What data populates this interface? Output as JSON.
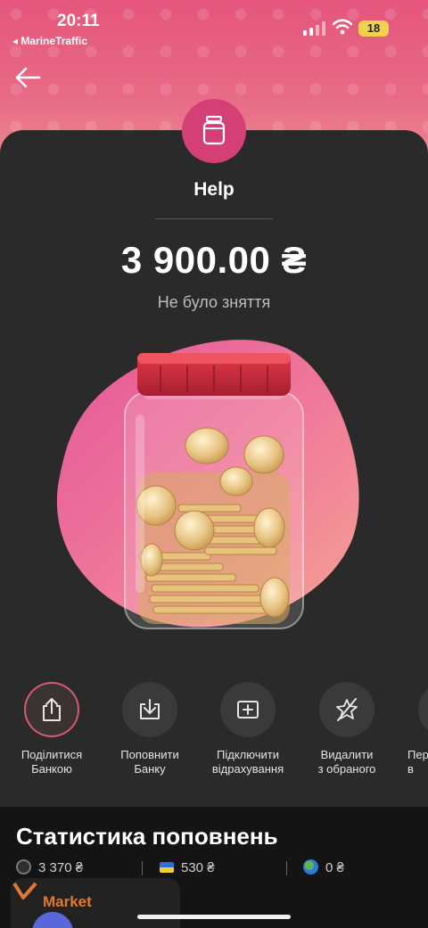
{
  "status_bar": {
    "time": "20:11",
    "back_app": "◂ MarineTraffic",
    "battery": "18"
  },
  "jar": {
    "title": "Help",
    "amount": "3 900.00 ₴",
    "subtitle": "Не було зняття"
  },
  "actions": [
    {
      "label": "Поділитися\nБанкою",
      "icon": "share-icon"
    },
    {
      "label": "Поповнити\nБанку",
      "icon": "download-tray-icon"
    },
    {
      "label": "Підключити\nвідрахування",
      "icon": "plus-square-icon"
    },
    {
      "label": "Видалити\nз обраного",
      "icon": "star-crossed-icon"
    },
    {
      "label": "Пер\nв",
      "icon": "partial-icon"
    }
  ],
  "stats": {
    "title": "Статистика поповнень",
    "items": [
      {
        "value": "3 370 ₴",
        "icon": "m-circle-icon"
      },
      {
        "value": "530 ₴",
        "icon": "ukraine-flag-icon"
      },
      {
        "value": "0 ₴",
        "icon": "globe-icon"
      }
    ]
  },
  "market": {
    "label": "Market"
  },
  "colors": {
    "accent": "#d43f75",
    "card": "#2a2a2a",
    "stats_bg": "#141414"
  }
}
